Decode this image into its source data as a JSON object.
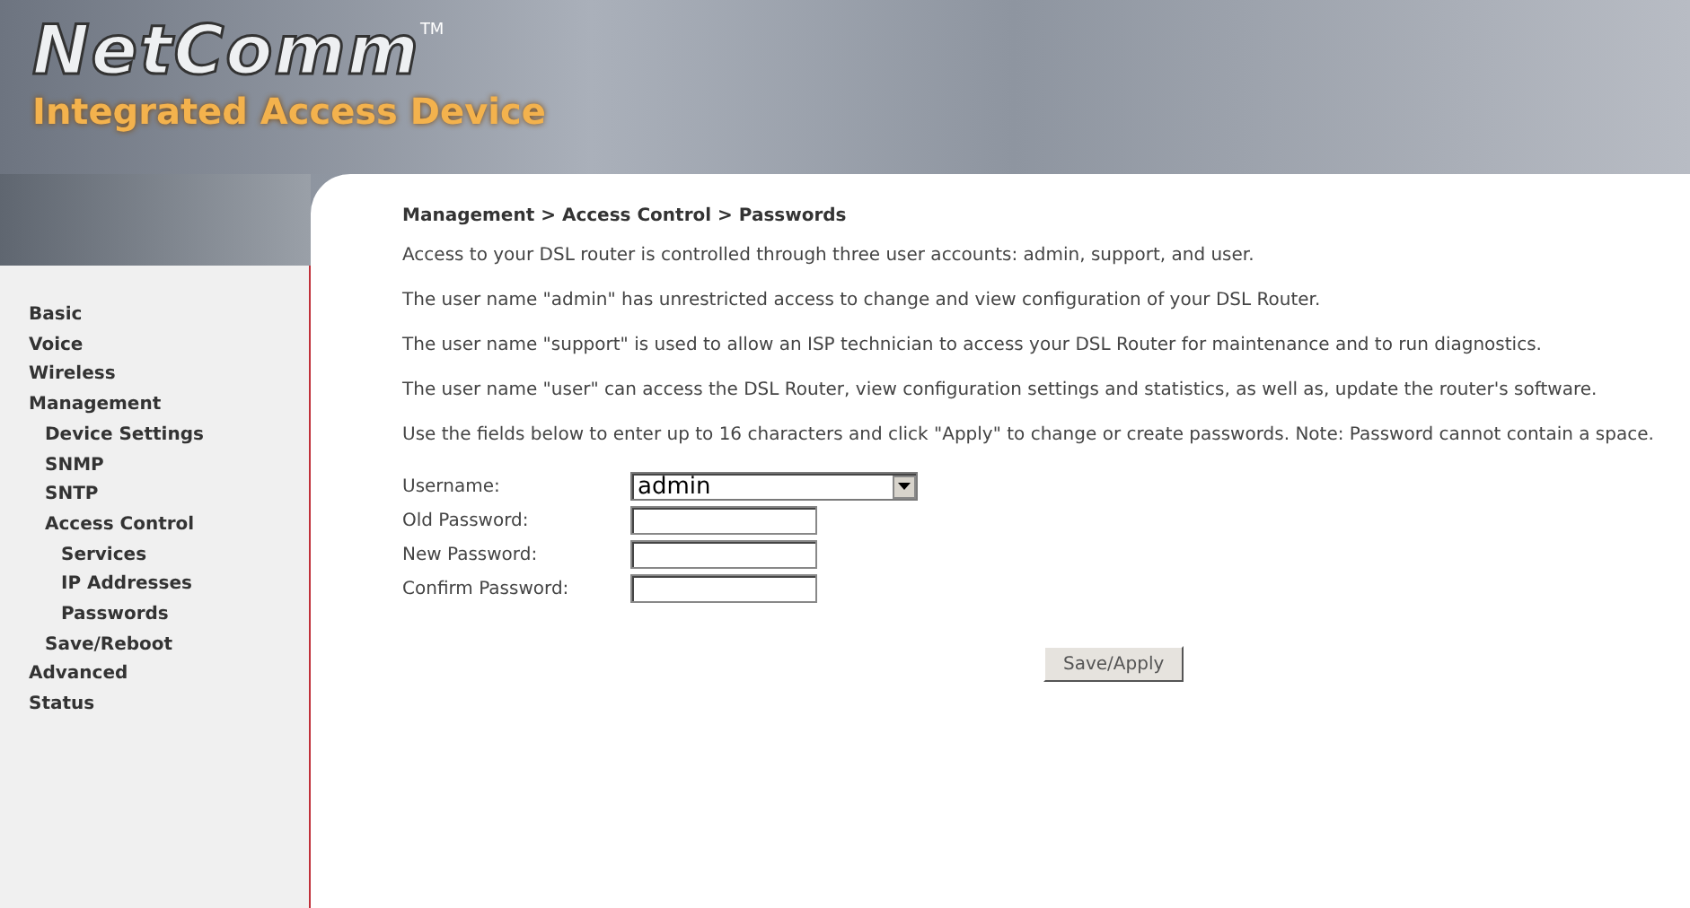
{
  "header": {
    "logo": "NetComm",
    "trademark": "TM",
    "product": "Integrated Access Device"
  },
  "sidebar": {
    "items": [
      {
        "label": "Basic"
      },
      {
        "label": "Voice"
      },
      {
        "label": "Wireless"
      },
      {
        "label": "Management",
        "children": [
          {
            "label": "Device Settings"
          },
          {
            "label": "SNMP"
          },
          {
            "label": "SNTP"
          },
          {
            "label": "Access Control",
            "children": [
              {
                "label": "Services"
              },
              {
                "label": "IP Addresses"
              },
              {
                "label": "Passwords"
              }
            ]
          },
          {
            "label": "Save/Reboot"
          }
        ]
      },
      {
        "label": "Advanced"
      },
      {
        "label": "Status"
      }
    ]
  },
  "breadcrumb": "Management > Access Control > Passwords",
  "paragraphs": [
    "Access to your DSL router is controlled through three user accounts: admin, support, and user.",
    "The user name \"admin\" has unrestricted access to change and view configuration of your DSL Router.",
    "The user name \"support\" is used to allow an ISP technician to access your DSL Router for maintenance and to run diagnostics.",
    "The user name \"user\" can access the DSL Router, view configuration settings and statistics, as well as, update the router's software.",
    "Use the fields below to enter up to 16 characters and click \"Apply\" to change or create passwords. Note: Password cannot contain a space."
  ],
  "form": [
    {
      "kind": "select",
      "label": "Username:",
      "value": "admin"
    },
    {
      "kind": "password",
      "label": "Old Password:"
    },
    {
      "kind": "password",
      "label": "New Password:"
    },
    {
      "kind": "password",
      "label": "Confirm Password:"
    }
  ],
  "save_button": "Save/Apply"
}
